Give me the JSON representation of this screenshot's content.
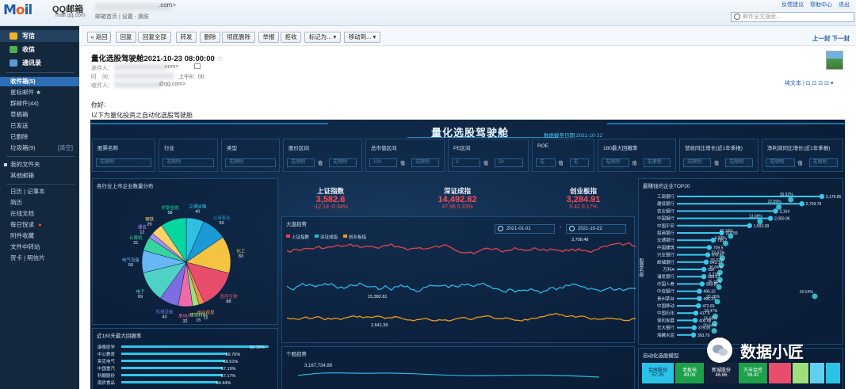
{
  "app": {
    "logo": "Mail",
    "brand": "QQ邮箱",
    "brand_sub": "mail.qq.com",
    "account_tail": ".com>",
    "account_sub": "邮箱首页 | 设置 - 换肤",
    "top_links": [
      "反馈建议",
      "帮助中心",
      "退出"
    ],
    "search_placeholder": "邮件全文搜索..."
  },
  "sidebar": {
    "write": "写信",
    "inbox_btn": "收信",
    "contacts": "通讯录",
    "folders": [
      {
        "label": "收件箱(5)"
      },
      {
        "label": "星标邮件 ★"
      },
      {
        "label": "群邮件(44)"
      },
      {
        "label": "草稿箱"
      },
      {
        "label": "已发送"
      },
      {
        "label": "已删除"
      },
      {
        "label": "垃圾箱(9)",
        "extra": "[清空]"
      }
    ],
    "my_folders": "我的文件夹",
    "other_mail": "其他邮箱",
    "apps": [
      "日历 | 记事本",
      "简历",
      "在线文档",
      "每日悦读",
      "附件收藏",
      "文件中转站",
      "贺卡 | 明信片"
    ]
  },
  "toolbar": {
    "buttons": [
      "« 返回",
      "回复",
      "回复全部",
      "转发",
      "删除",
      "彻底删除",
      "举报",
      "拒收",
      "标记为... ▾",
      "移动到... ▾"
    ],
    "nav": "上一封 下一封"
  },
  "email": {
    "subject": "量化选股驾驶舱2021-10-23 08:00:00",
    "from_label": "发件人：",
    "from_tail": "com>",
    "time_label": "时　间：",
    "time_value": "上午8：00",
    "to_label": "收件人：",
    "to_tail": "@qq.com>",
    "plain_text": "纯文本 | ⊡ ⊡ ⊡ ⊡ ▾",
    "greeting": "你好:",
    "intro": "以下为量化投资之自动化选股驾驶舱"
  },
  "dashboard": {
    "title": "量化选股驾驶舱",
    "date_label": "数据截至日期:2021-10-22",
    "filters": [
      {
        "label": "股票名称",
        "value": "无限制"
      },
      {
        "label": "行业",
        "value": "无限制"
      },
      {
        "label": "类型",
        "value": "无限制"
      },
      {
        "label": "股价区间",
        "left": "无限制",
        "mid": "值",
        "right": "无限制"
      },
      {
        "label": "总市值区间",
        "left": "100",
        "mid": "值",
        "right": "无限制"
      },
      {
        "label": "PE区间",
        "left": "3",
        "mid": "值",
        "right": "50"
      },
      {
        "label": "ROE",
        "left": "无",
        "mid": "值",
        "right": "无"
      },
      {
        "label": "180最大回撤率",
        "left": "无限制",
        "mid": "值",
        "right": "无限制"
      },
      {
        "label": "营收同比增长(近1年季报)",
        "left": "无限制",
        "mid": "值",
        "right": "无限制"
      },
      {
        "label": "净利润同比增长(近1年季报)",
        "left": "无限制",
        "mid": "值",
        "right": "无限制"
      }
    ],
    "pie_title": "各行业上市企业数量分布",
    "drawdown_title": "近180天最大回撤率",
    "drawdown_items": [
      {
        "name": "康泰医学",
        "value": "83.10%"
      },
      {
        "name": "中公教育",
        "value": "59.76%"
      },
      {
        "name": "英克电气",
        "value": "58.51%"
      },
      {
        "name": "中国重汽",
        "value": "57.19%"
      },
      {
        "name": "科顺股份",
        "value": "57.17%"
      },
      {
        "name": "南侨食品",
        "value": "54.44%"
      }
    ],
    "indices": [
      {
        "name": "上证指数",
        "value": "3,582.6",
        "change": "-12.18  -0.34%"
      },
      {
        "name": "深证成指",
        "value": "14,492.82",
        "change": "47.96 0.33%"
      },
      {
        "name": "创业板指",
        "value": "3,284.91",
        "change": "5.42  0.17%"
      }
    ],
    "trend_title": "大盘趋势",
    "trend_legend": [
      "上证指数",
      "深证成指",
      "创业板指"
    ],
    "date_from": "2021-01-01",
    "date_to": "2021-10-22",
    "trend_labels": [
      "3,708.48",
      "15,382.81",
      "2,641.39"
    ],
    "stock_trend_title": "个股趋势",
    "stock_trend_label": "3,167,734.86",
    "top20_title": "最赚钱的企业TOP20",
    "top20_axis_label": "股票名称",
    "model_title": "自动化选股模型",
    "treemap": [
      {
        "name": "金辰股份",
        "value": "57.25"
      },
      {
        "name": "老板电",
        "value": "49.06"
      },
      {
        "name": "新城股份",
        "value": "46.66"
      },
      {
        "name": "万丰金控",
        "value": "39.42"
      }
    ],
    "watermark": "数据小匠"
  },
  "chart_data": [
    {
      "type": "pie",
      "title": "各行业上市企业数量分布",
      "slices": [
        {
          "label": "交通运输",
          "value": 40
        },
        {
          "label": "公用事业",
          "value": 55
        },
        {
          "label": "化工",
          "value": 83
        },
        {
          "label": "医药生物",
          "value": 88
        },
        {
          "label": "商业贸易",
          "value": 12
        },
        {
          "label": "建筑材料",
          "value": 15
        },
        {
          "label": "房地产",
          "value": 32
        },
        {
          "label": "机械设备",
          "value": 43
        },
        {
          "label": "电子",
          "value": 69
        },
        {
          "label": "电气设备",
          "value": 50
        },
        {
          "label": "计算机",
          "value": 31
        },
        {
          "label": "通信",
          "value": 12
        },
        {
          "label": "钢铁",
          "value": 26
        },
        {
          "label": "非银金融",
          "value": 58
        }
      ]
    },
    {
      "type": "bar",
      "title": "近180天最大回撤率",
      "categories": [
        "康泰医学",
        "中公教育",
        "英克电气",
        "中国重汽",
        "科顺股份",
        "南侨食品"
      ],
      "values": [
        83.1,
        59.76,
        58.51,
        57.19,
        57.17,
        54.44
      ]
    },
    {
      "type": "line",
      "title": "大盘趋势",
      "series": [
        {
          "name": "上证指数",
          "color": "#e5434f"
        },
        {
          "name": "深证成指",
          "color": "#2ab8e0"
        },
        {
          "name": "创业板指",
          "color": "#f09a1a"
        }
      ],
      "x": [
        "2021-01-01",
        "2021-10-22"
      ],
      "labels": [
        "3,708.48",
        "15,382.81",
        "2,641.39"
      ]
    },
    {
      "type": "bar",
      "title": "最赚钱的企业TOP20",
      "ylabel": "股票名称",
      "categories": [
        "工商银行",
        "建设银行",
        "农业银行",
        "中国银行",
        "中国平安",
        "招商银行",
        "交通银行",
        "中国建筑",
        "兴业银行",
        "邮储银行",
        "万科A",
        "浦发银行",
        "中国人寿",
        "中信银行",
        "贵州茅台",
        "中国移动",
        "中国石化",
        "保利发展",
        "光大银行",
        "海螺水泥"
      ],
      "values": [
        3176.85,
        2739.79,
        2164,
        2050.96,
        1593.39,
        979.59,
        795.7,
        709.5,
        676.81,
        643.18,
        592,
        589.93,
        553.85,
        495.32,
        495.23,
        472.65,
        417.5,
        400.48,
        379.05,
        363.79
      ],
      "secondary_labels": [
        "35.52%",
        "22.89%",
        "",
        "13.08%",
        "",
        "32.16%",
        "4.39%",
        "",
        "22.47%",
        "33.32%",
        "30.04%",
        "6.23%",
        "25.44%",
        "",
        "20.26%",
        "",
        "18.47%",
        "26.68%",
        "20.64%",
        ""
      ],
      "outlier_label": "50.54%"
    }
  ]
}
